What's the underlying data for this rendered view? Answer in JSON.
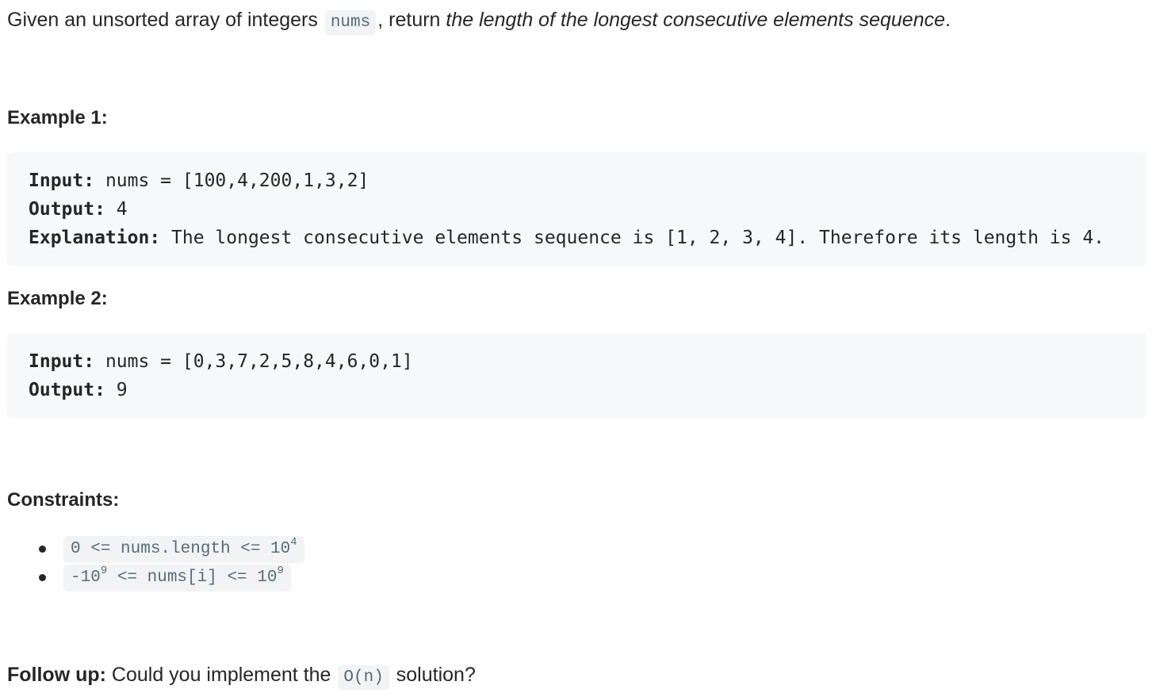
{
  "intro": {
    "prefix": "Given an unsorted array of integers ",
    "code": "nums",
    "middle": ", return ",
    "emphasis": "the length of the longest consecutive elements sequence",
    "suffix": "."
  },
  "examples": [
    {
      "heading": "Example 1:",
      "lines": [
        {
          "label": "Input:",
          "value": " nums = [100,4,200,1,3,2]"
        },
        {
          "label": "Output:",
          "value": " 4"
        },
        {
          "label": "Explanation:",
          "value": " The longest consecutive elements sequence is [1, 2, 3, 4]. Therefore its length is 4."
        }
      ]
    },
    {
      "heading": "Example 2:",
      "lines": [
        {
          "label": "Input:",
          "value": " nums = [0,3,7,2,5,8,4,6,0,1]"
        },
        {
          "label": "Output:",
          "value": " 9"
        }
      ]
    }
  ],
  "constraints": {
    "heading": "Constraints:",
    "items": [
      {
        "pre": "0 <= nums.length <= 10",
        "sup1": "4",
        "mid": "",
        "sup2": ""
      },
      {
        "pre": "-10",
        "sup1": "9",
        "mid": " <= nums[i] <= 10",
        "sup2": "9"
      }
    ]
  },
  "followup": {
    "label": "Follow up:",
    "text_before": " Could you implement the ",
    "code": "O(n)",
    "text_after": " solution?"
  }
}
